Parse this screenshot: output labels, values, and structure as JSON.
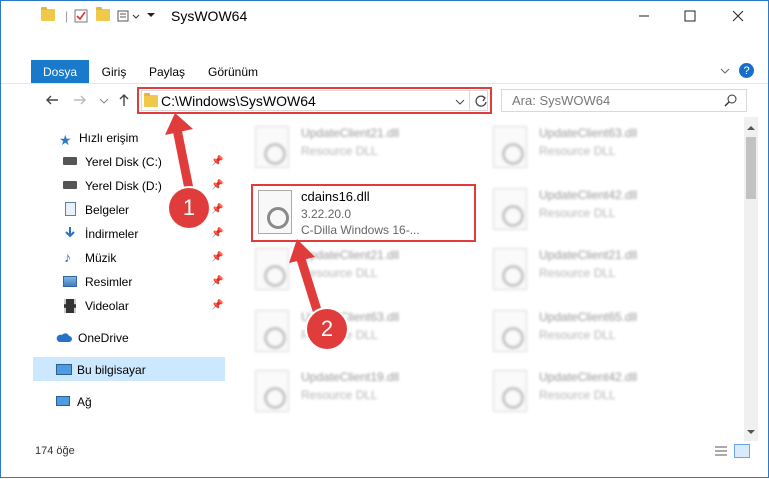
{
  "window": {
    "title": "SysWOW64"
  },
  "ribbon": {
    "tabs": [
      "Dosya",
      "Giriş",
      "Paylaş",
      "Görünüm"
    ]
  },
  "address": {
    "path": "C:\\Windows\\SysWOW64"
  },
  "search": {
    "placeholder": "Ara: SysWOW64"
  },
  "sidebar": {
    "items": [
      {
        "label": "Hızlı erişim",
        "icon": "star-icon"
      },
      {
        "label": "Yerel Disk (C:)",
        "icon": "drive-icon",
        "pinned": true
      },
      {
        "label": "Yerel Disk (D:)",
        "icon": "drive-icon",
        "pinned": true
      },
      {
        "label": "Belgeler",
        "icon": "documents-icon",
        "pinned": true
      },
      {
        "label": "İndirmeler",
        "icon": "download-icon",
        "pinned": true
      },
      {
        "label": "Müzik",
        "icon": "music-icon",
        "pinned": true
      },
      {
        "label": "Resimler",
        "icon": "pictures-icon",
        "pinned": true
      },
      {
        "label": "Videolar",
        "icon": "video-icon",
        "pinned": true
      },
      {
        "label": "OneDrive",
        "icon": "cloud-icon"
      },
      {
        "label": "Bu bilgisayar",
        "icon": "computer-icon",
        "selected": true
      },
      {
        "label": "Ağ",
        "icon": "network-icon"
      }
    ]
  },
  "files": {
    "left_col": [
      "UpdateClient21.dll",
      "UpdateClient21.dll",
      "UpdateClient63.dll",
      "UpdateClient65.dll",
      "UpdateClient19.dll"
    ],
    "right_col": [
      "UpdateClient63.dll",
      "UpdateClient42.dll",
      "UpdateClient21.dll",
      "UpdateClient65.dll",
      "UpdateClient63.dll",
      "UpdateClient42.dll"
    ],
    "desc": "Resource DLL",
    "highlight": {
      "name": "cdains16.dll",
      "version": "3.22.20.0",
      "desc": "C-Dilla Windows 16-..."
    }
  },
  "status": {
    "count": "174 öğe"
  },
  "callouts": [
    "1",
    "2"
  ],
  "colors": {
    "accent": "#1979ca",
    "callout": "#e03c3c"
  }
}
